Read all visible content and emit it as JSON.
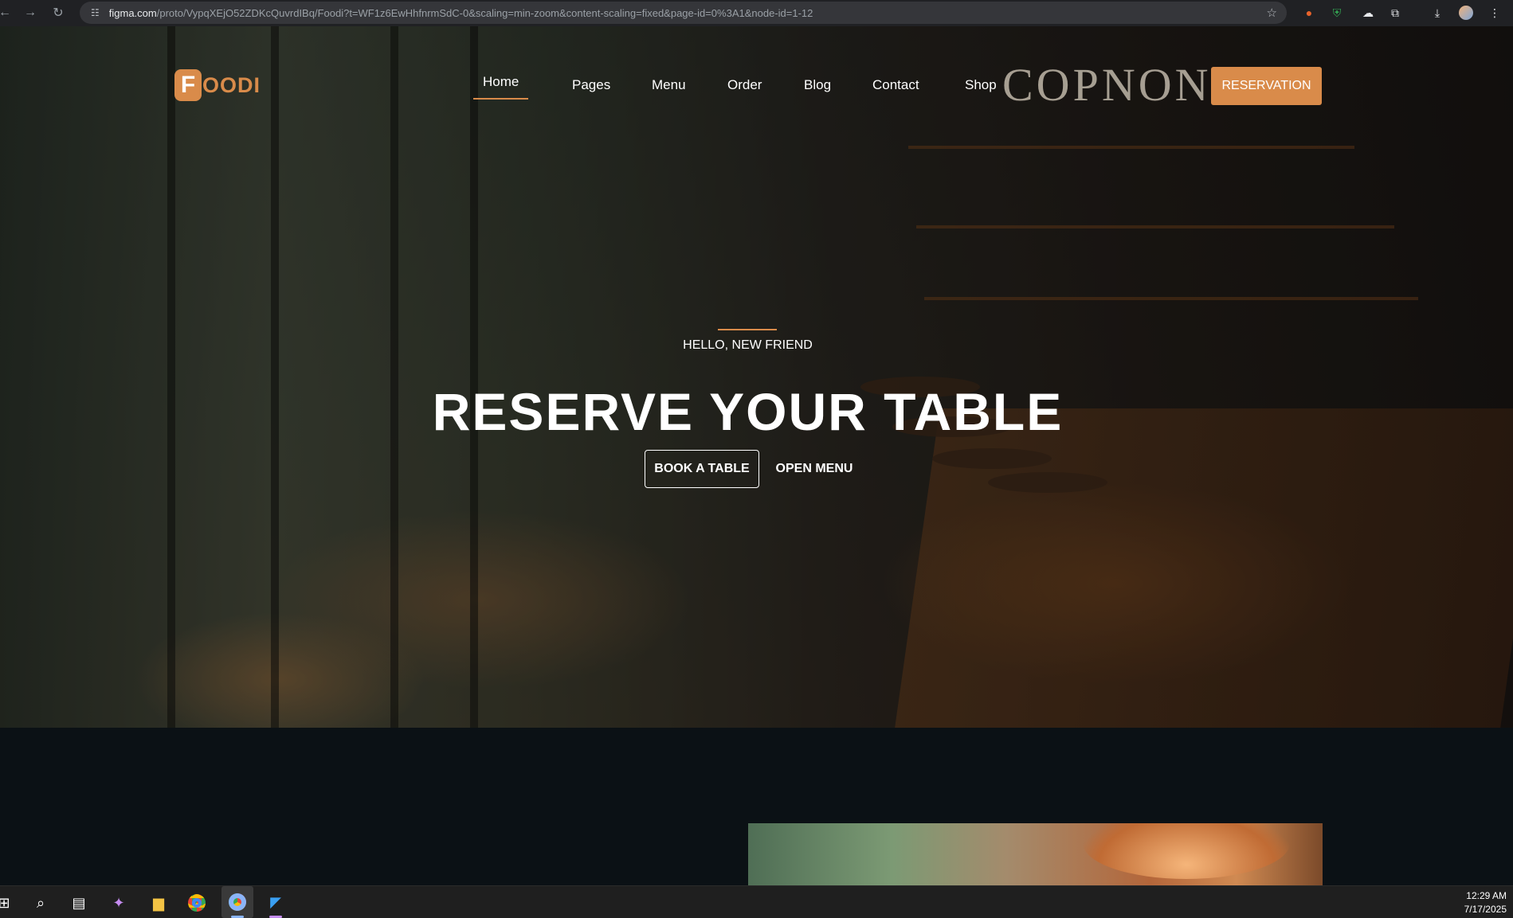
{
  "browser": {
    "url_host": "figma.com",
    "url_path": "/proto/VypqXEjO52ZDKcQuvrdIBq/Foodi?t=WF1z6EwHhfnrmSdC-0&scaling=min-zoom&content-scaling=fixed&page-id=0%3A1&node-id=1-12"
  },
  "site": {
    "logo_letter": "F",
    "logo_rest": "OODI",
    "nav": [
      {
        "label": "Home"
      },
      {
        "label": "Pages"
      },
      {
        "label": "Menu"
      },
      {
        "label": "Order"
      },
      {
        "label": "Blog"
      },
      {
        "label": "Contact"
      },
      {
        "label": "Shop"
      }
    ],
    "reservation_label": "RESERVATION",
    "sign_text": "COPNON"
  },
  "hero": {
    "kicker": "HELLO, NEW FRIEND",
    "headline": "RESERVE YOUR TABLE",
    "book_label": "BOOK A TABLE",
    "open_menu_label": "OPEN MENU"
  },
  "taskbar": {
    "time": "12:29 AM",
    "date": "7/17/2025"
  },
  "colors": {
    "accent": "#d98b4a",
    "page_bg": "#0b1115"
  }
}
